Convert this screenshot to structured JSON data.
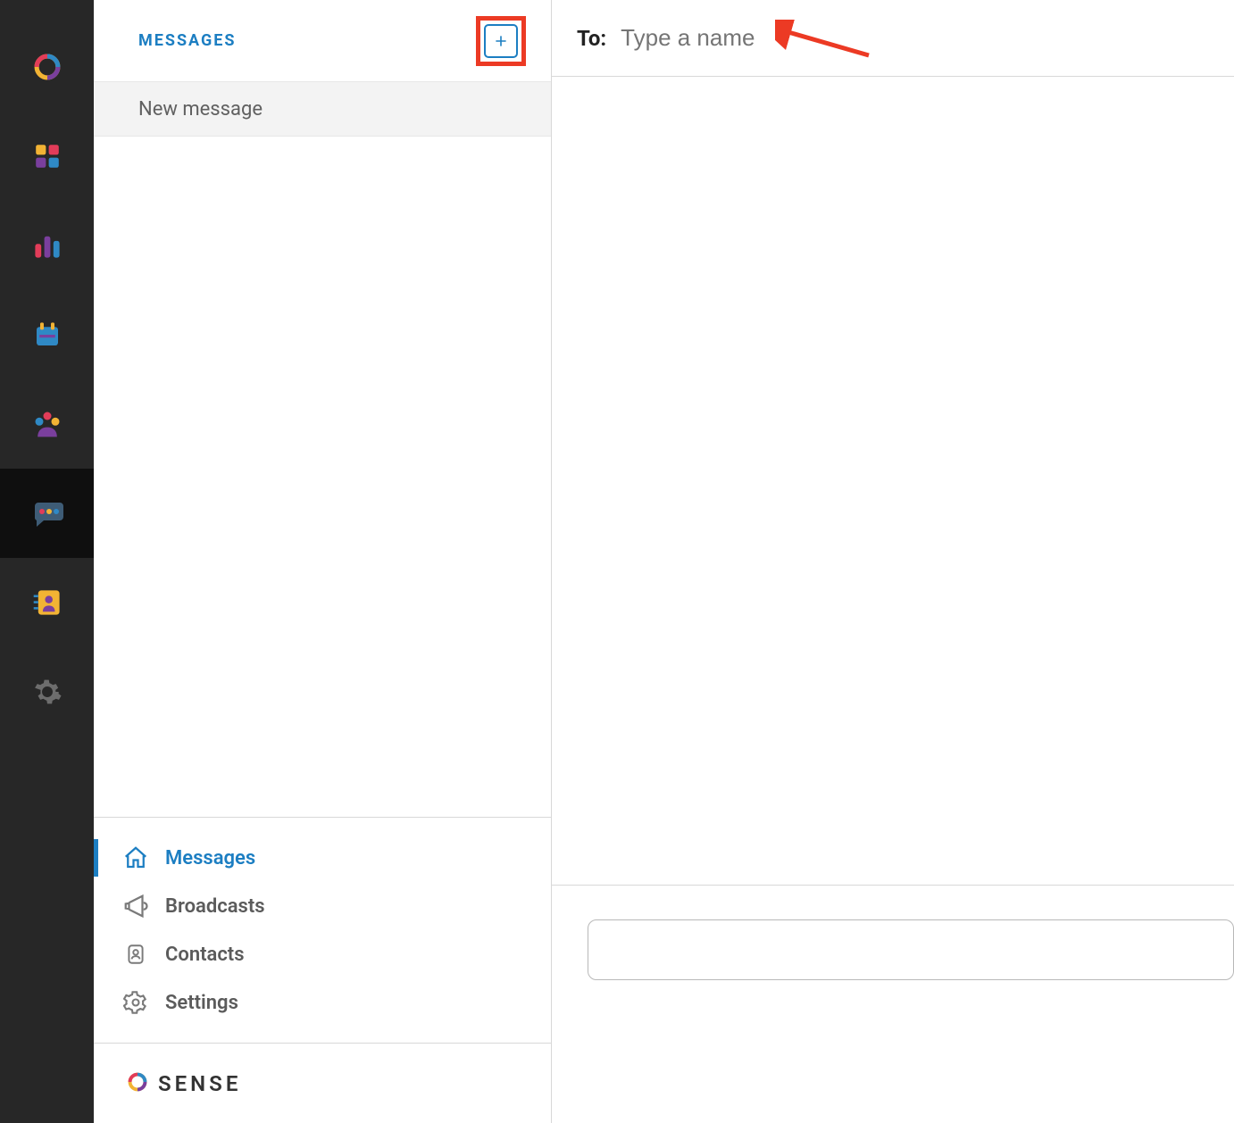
{
  "rail": {
    "items": [
      {
        "name": "logo"
      },
      {
        "name": "apps"
      },
      {
        "name": "analytics"
      },
      {
        "name": "calendar"
      },
      {
        "name": "people"
      },
      {
        "name": "messaging",
        "active": true
      },
      {
        "name": "contacts-book"
      },
      {
        "name": "settings"
      }
    ]
  },
  "messages_panel": {
    "title": "MESSAGES",
    "new_message_row": "New message"
  },
  "sub_nav": {
    "items": [
      {
        "label": "Messages",
        "icon": "home",
        "active": true
      },
      {
        "label": "Broadcasts",
        "icon": "megaphone"
      },
      {
        "label": "Contacts",
        "icon": "contact"
      },
      {
        "label": "Settings",
        "icon": "gear"
      }
    ]
  },
  "brand": "SENSE",
  "compose": {
    "to_label": "To:",
    "to_placeholder": "Type a name"
  }
}
